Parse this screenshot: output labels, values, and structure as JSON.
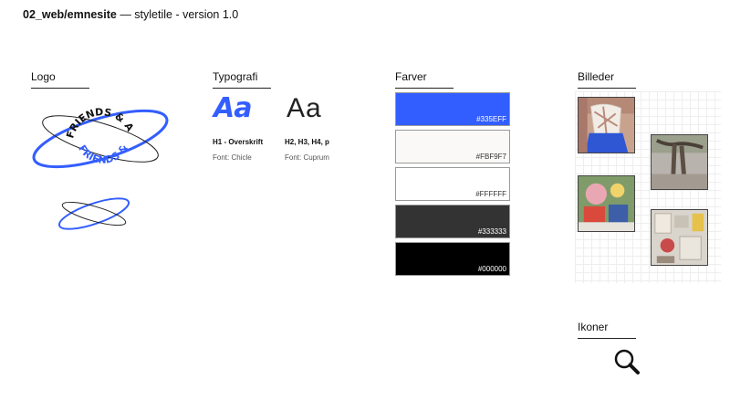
{
  "header": {
    "path": "02_web/emnesite",
    "subtitle": " — styletile - version 1.0"
  },
  "sections": {
    "logo": "Logo",
    "typography": "Typografi",
    "colors": "Farver",
    "images": "Billeder",
    "icons": "Ikoner"
  },
  "logo": {
    "text_top": "FRIENDS & ART",
    "text_bottom": "FRIENDS & ART",
    "brand_color": "#335EFF"
  },
  "typography": [
    {
      "sample": "Aa",
      "usage": "H1 - Overskrift",
      "font": "Font: Chicle"
    },
    {
      "sample": "Aa",
      "usage": "H2, H3, H4, p",
      "font": "Font: Cuprum"
    }
  ],
  "colors": [
    {
      "hex": "#335EFF",
      "label": "#335EFF"
    },
    {
      "hex": "#FBF9F7",
      "label": "#FBF9F7"
    },
    {
      "hex": "#FFFFFF",
      "label": "#FFFFFF"
    },
    {
      "hex": "#333333",
      "label": "#333333"
    },
    {
      "hex": "#000000",
      "label": "#000000"
    }
  ],
  "images": [
    "photo-clothing",
    "photo-tree",
    "photo-collage",
    "photo-art-wall"
  ],
  "icons": [
    "search-icon"
  ]
}
